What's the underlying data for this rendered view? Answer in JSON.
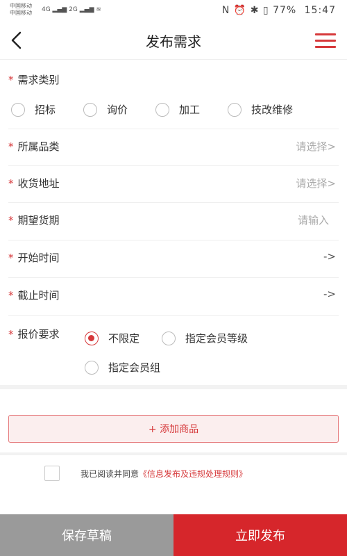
{
  "status_bar": {
    "carrier_1": "中国移动",
    "carrier_2": "中国移动",
    "left_icons": "4G ▂▄▆ 2G ▂▄▆ ≋",
    "right_icons": "N ⏰ ✱ ▯",
    "battery": "77%",
    "time": "15:47"
  },
  "nav": {
    "title": "发布需求",
    "icons": {
      "back": "chevron-left-icon",
      "menu": "hamburger-menu-icon"
    },
    "accent": "#d6393b"
  },
  "form": {
    "category": {
      "required_mark": "*",
      "label": "需求类别",
      "options": [
        "招标",
        "询价",
        "加工",
        "技改维修"
      ]
    },
    "product_category": {
      "required_mark": "*",
      "label": "所属品类",
      "hint": "请选择>"
    },
    "address": {
      "required_mark": "*",
      "label": "收货地址",
      "hint": "请选择>"
    },
    "delivery": {
      "required_mark": "*",
      "label": "期望货期",
      "hint": "请输入"
    },
    "start_time": {
      "required_mark": "*",
      "label": "开始时间",
      "hint": "->"
    },
    "end_time": {
      "required_mark": "*",
      "label": "截止时间",
      "hint": "->"
    },
    "quote": {
      "required_mark": "*",
      "label": "报价要求",
      "options": [
        "不限定",
        "指定会员等级",
        "指定会员组"
      ],
      "selected": "不限定"
    }
  },
  "add_goods": {
    "label": "+ 添加商品"
  },
  "agreement": {
    "text": "我已阅读并同意",
    "link": "《信息发布及违规处理规则》"
  },
  "bottom": {
    "save_label": "保存草稿",
    "publish_label": "立即发布",
    "colors": {
      "draft": "#9a9a9a",
      "publish": "#d6262b"
    }
  }
}
